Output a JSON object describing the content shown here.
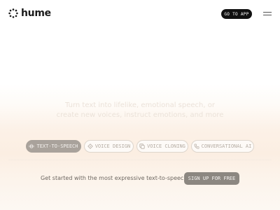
{
  "header": {
    "logo_text": "hume",
    "go_to_app_label": "GO TO APP",
    "menu_icon": "hamburger-menu-icon"
  },
  "hero": {
    "line1": "Turn text into lifelike, emotional speech, or",
    "line2": "create new voices, instruct emotions, and more"
  },
  "products": [
    {
      "label": "TEXT-TO-SPEECH",
      "icon": "waveform-icon",
      "active": true
    },
    {
      "label": "VOICE DESIGN",
      "icon": "design-icon",
      "active": false
    },
    {
      "label": "VOICE CLONING",
      "icon": "copy-icon",
      "active": false
    },
    {
      "label": "CONVERSATIONAL AI",
      "icon": "phone-icon",
      "active": false
    }
  ],
  "cta": {
    "text": "Get started with the most expressive text-to-speech",
    "button_label": "SIGN UP FOR FREE"
  },
  "colors": {
    "button_dark": "#111111",
    "pill_active": "#a9a29b",
    "signup_button": "#8c8781"
  }
}
